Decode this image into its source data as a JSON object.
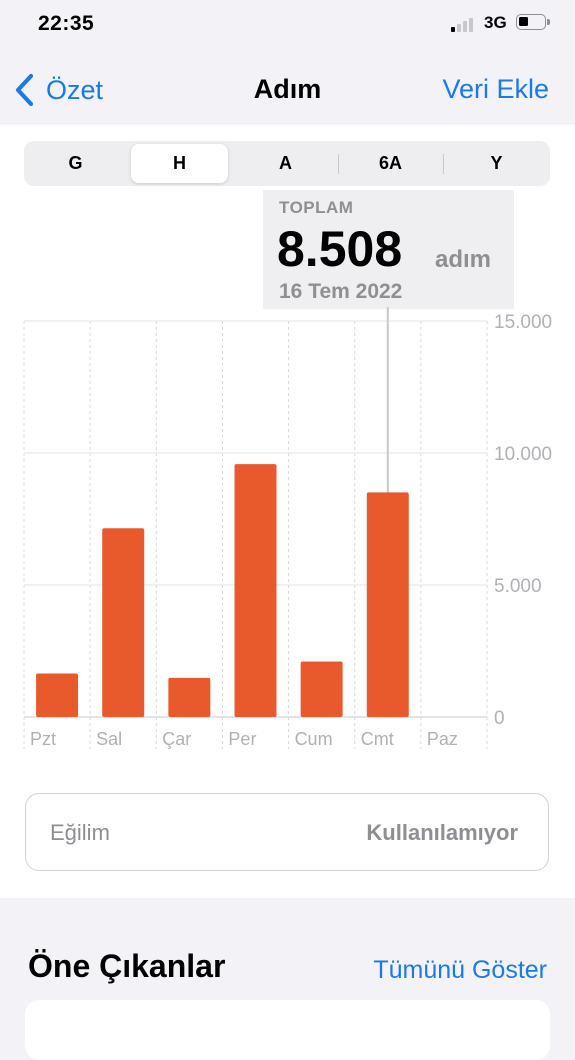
{
  "status": {
    "time": "22:35",
    "network": "3G"
  },
  "nav": {
    "back_label": "Özet",
    "title": "Adım",
    "add_label": "Veri Ekle"
  },
  "segments": [
    "G",
    "H",
    "A",
    "6A",
    "Y"
  ],
  "active_segment": "H",
  "tooltip": {
    "label": "TOPLAM",
    "value": "8.508",
    "unit": "adım",
    "date": "16 Tem 2022"
  },
  "chart_data": {
    "type": "bar",
    "categories": [
      "Pzt",
      "Sal",
      "Çar",
      "Per",
      "Cum",
      "Cmt",
      "Paz"
    ],
    "values": [
      1650,
      7150,
      1480,
      9580,
      2100,
      8508,
      0
    ],
    "y_ticks": [
      "15.000",
      "10.000",
      "5.000",
      "0"
    ],
    "ylim": [
      0,
      15000
    ],
    "selected_index": 5,
    "bar_color": "#e85a2c",
    "grid": true
  },
  "trend": {
    "label": "Eğilim",
    "value": "Kullanılamıyor"
  },
  "highlights": {
    "title": "Öne Çıkanlar",
    "show_all": "Tümünü Göster"
  },
  "colors": {
    "accent": "#1a7ae8",
    "bar": "#e85a2c"
  }
}
